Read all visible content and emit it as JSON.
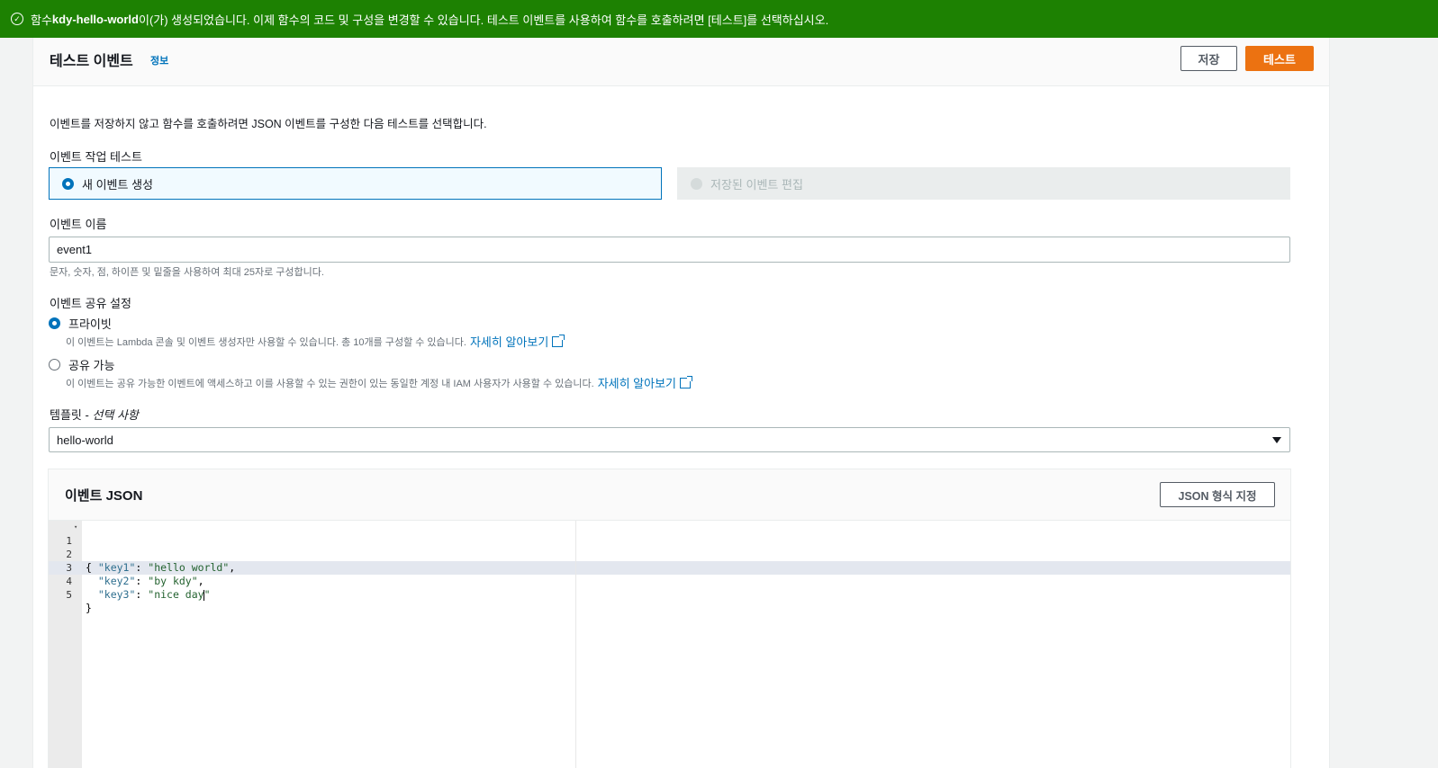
{
  "flash": {
    "prefix": "함수 ",
    "function_name": "kdy-hello-world",
    "message": "이(가) 생성되었습니다. 이제 함수의 코드 및 구성을 변경할 수 있습니다. 테스트 이벤트를 사용하여 함수를 호출하려면 [테스트]를 선택하십시오."
  },
  "header": {
    "title": "테스트 이벤트",
    "info_link": "정보",
    "save_label": "저장",
    "test_label": "테스트"
  },
  "description": "이벤트를 저장하지 않고 함수를 호출하려면 JSON 이벤트를 구성한 다음 테스트를 선택합니다.",
  "test_event_action": {
    "label": "이벤트 작업 테스트",
    "options": [
      "새 이벤트 생성",
      "저장된 이벤트 편집"
    ],
    "selected": "새 이벤트 생성"
  },
  "event_name": {
    "label": "이벤트 이름",
    "value": "event1",
    "hint": "문자, 숫자, 점, 하이픈 및 밑줄을 사용하여 최대 25자로 구성합니다."
  },
  "sharing": {
    "label": "이벤트 공유 설정",
    "private": {
      "label": "프라이빗",
      "desc": "이 이벤트는 Lambda 콘솔 및 이벤트 생성자만 사용할 수 있습니다. 총 10개를 구성할 수 있습니다.",
      "learn_more": "자세히 알아보기"
    },
    "shareable": {
      "label": "공유 가능",
      "desc": "이 이벤트는 공유 가능한 이벤트에 액세스하고 이를 사용할 수 있는 권한이 있는 동일한 계정 내 IAM 사용자가 사용할 수 있습니다.",
      "learn_more": "자세히 알아보기"
    },
    "selected": "프라이빗"
  },
  "template": {
    "label": "템플릿 - ",
    "label_optional": "선택 사항",
    "value": "hello-world"
  },
  "event_json": {
    "title": "이벤트 JSON",
    "format_label": "JSON 형식 지정",
    "lines": [
      {
        "num": "1",
        "open": "{"
      },
      {
        "num": "2",
        "key": "\"key1\"",
        "val": "\"hello world\"",
        "tail": ","
      },
      {
        "num": "3",
        "key": "\"key2\"",
        "val": "\"by kdy\"",
        "tail": ","
      },
      {
        "num": "4",
        "key": "\"key3\"",
        "val_a": "\"nice day",
        "val_b": "\""
      },
      {
        "num": "5",
        "close": "}"
      }
    ]
  },
  "colors": {
    "flash_success": "#1d8102",
    "primary_button": "#ec7211",
    "link": "#0073bb"
  }
}
